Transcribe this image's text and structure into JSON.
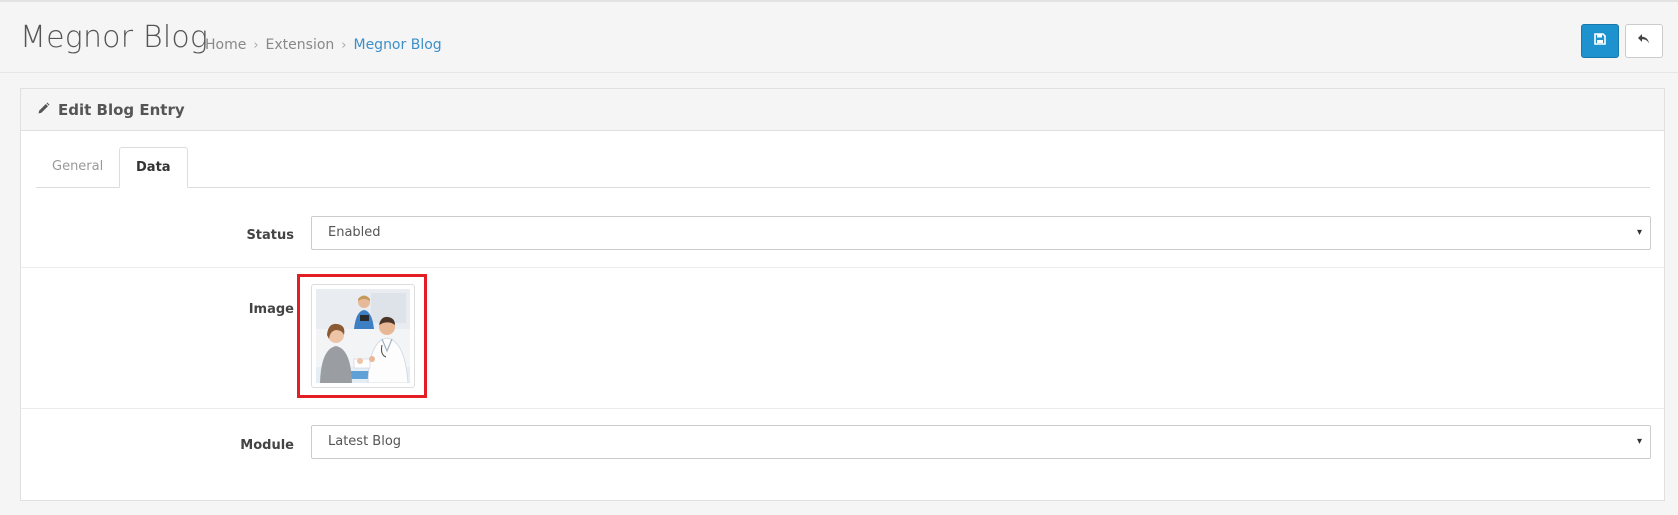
{
  "header": {
    "title": "Megnor Blog",
    "breadcrumb": [
      "Home",
      "Extension",
      "Megnor Blog"
    ],
    "breadcrumb_sep": "›",
    "save_icon": "save-icon",
    "back_icon": "reply-icon",
    "accent_color": "#1e91cf"
  },
  "panel": {
    "title": "Edit Blog Entry",
    "title_icon": "pencil-icon"
  },
  "tabs": [
    {
      "label": "General",
      "active": false
    },
    {
      "label": "Data",
      "active": true
    }
  ],
  "form": {
    "status": {
      "label": "Status",
      "value": "Enabled"
    },
    "image": {
      "label": "Image"
    },
    "module": {
      "label": "Module",
      "value": "Latest Blog"
    }
  },
  "caret_glyph": "▾",
  "highlight_color": "#e31e24"
}
